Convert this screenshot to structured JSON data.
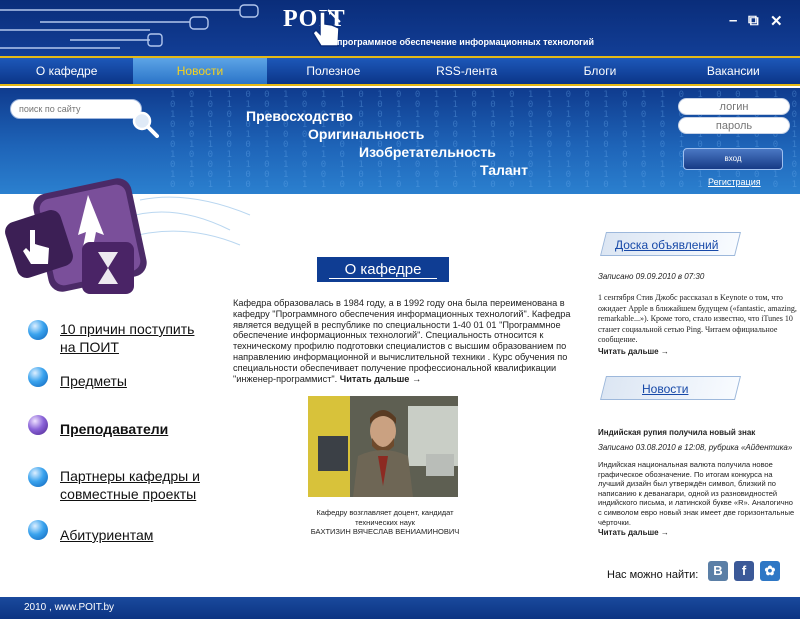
{
  "logo": {
    "text": "POIT",
    "tagline": "программное обеспечение информационных технологий"
  },
  "window_controls": {
    "minimize": "–",
    "maximize": "⧉",
    "close": "✕"
  },
  "nav": {
    "items": [
      {
        "label": "О кафедре"
      },
      {
        "label": "Новости"
      },
      {
        "label": "Полезное"
      },
      {
        "label": "RSS-лента"
      },
      {
        "label": "Блоги"
      },
      {
        "label": "Вакансии"
      }
    ],
    "active": "Новости"
  },
  "search": {
    "placeholder": "поиск по сайту"
  },
  "slogans": [
    "Превосходство",
    "Оригинальность",
    "Изобретательность",
    "Талант"
  ],
  "auth": {
    "login_placeholder": "логин",
    "password_placeholder": "пароль",
    "submit": "вход",
    "register": "Регистрация"
  },
  "sidebar": {
    "items": [
      {
        "label_line1": "10 причин поступить",
        "label_line2": "на ПОИТ"
      },
      {
        "label": "Предметы"
      },
      {
        "label": "Преподаватели"
      },
      {
        "label_line1": "Партнеры кафедры и",
        "label_line2": "совместные проекты"
      },
      {
        "label": "Абитуриентам"
      }
    ]
  },
  "main": {
    "title": "О кафедре",
    "text": "Кафедра образовалась в 1984 году, а в 1992 году она была переименована в кафедру \"Программного обеспечения информационных технологий\". Кафедра является ведущей в республике по специальности 1-40 01 01 \"Программное обеспечение информационных технологий\". Специальность относится к техническому профилю подготовки специалистов с высшим образованием по направлению информационной и вычислительной техники . Курс обучения по специальности обеспечивает получение профессиональной квалификации \"инженер-программист\".",
    "more": "Читать дальше →",
    "caption_line1": "Кафедру возглавляет доцент, кандидат технических наук",
    "caption_line2": "БАХТИЗИН ВЯЧЕСЛАВ ВЕНИАМИНОВИЧ"
  },
  "announcements": {
    "title": "Доска объявлений",
    "date": "Записано 09.09.2010 в 07:30",
    "text": "1 сентября Стив Джобс рассказал в Keynote о том, что ожидает Apple в ближайшем будущем («fantastic, amazing, remarkable...»). Кроме того, стало известно, что iTunes 10 станет социальной сетью Ping. Читаем официальное сообщение.",
    "more": "Читать дальше →"
  },
  "news": {
    "title": "Новости",
    "headline": "Индийская рупия получила новый знак",
    "date": "Записано 03.08.2010 в 12:08, рубрика «Айдентика»",
    "text": "Индийская национальная валюта получила новое графическое обозначение. По итогам конкурса на лучший дизайн был утверждён символ, близкий по написанию к деванагари, одной из разновидностей индийского письма, и латинской букве «R». Аналогично с символом евро новый знак имеет две горизонтальные чёрточки.",
    "more": "Читать дальше →"
  },
  "social": {
    "label": "Нас можно найти:",
    "vk": "В",
    "facebook": "f",
    "other": "✿"
  },
  "footer": {
    "text": "2010 , www.POIT.by"
  },
  "colors": {
    "header": "#0a2d7a",
    "nav_active": "#2a74c8",
    "accent": "#e5b915",
    "link": "#1749a8"
  }
}
